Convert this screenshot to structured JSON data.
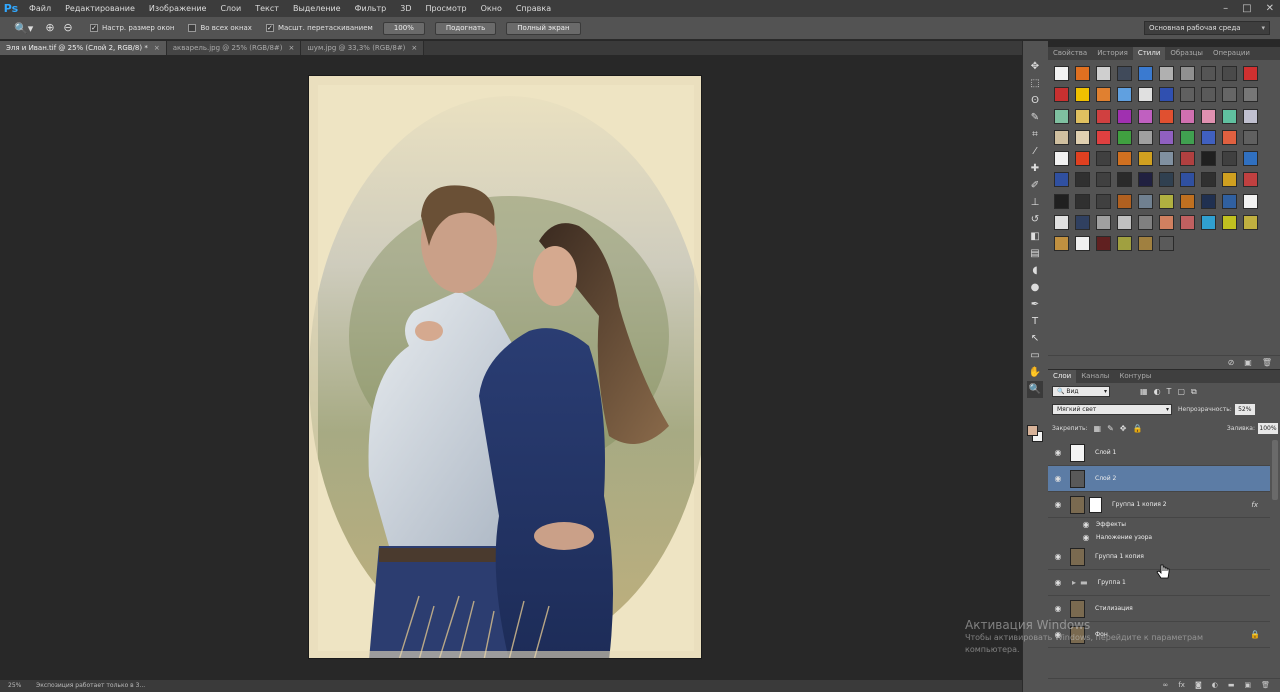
{
  "app": {
    "logo": "Ps"
  },
  "menu": [
    "Файл",
    "Редактирование",
    "Изображение",
    "Слои",
    "Текст",
    "Выделение",
    "Фильтр",
    "3D",
    "Просмотр",
    "Окно",
    "Справка"
  ],
  "window_controls": [
    "–",
    "□",
    "✕"
  ],
  "options_bar": {
    "resize_windows": "Настр. размер окон",
    "all_windows": "Во всех окнах",
    "scrubby_zoom": "Масшт. перетаскиванием",
    "zoom_100": "100%",
    "fit_screen": "Подогнать",
    "fill_screen": "Полный экран",
    "workspace": "Основная рабочая среда"
  },
  "doc_tabs": [
    {
      "label": "Эля и Иван.tif @ 25% (Слой 2, RGB/8) *",
      "close": "×",
      "active": true
    },
    {
      "label": "акварель.jpg @ 25% (RGB/8#)",
      "close": "×",
      "active": false
    },
    {
      "label": "шум.jpg @ 33,3% (RGB/8#)",
      "close": "×",
      "active": false
    }
  ],
  "status": {
    "zoom": "25%",
    "message": "Экспозиция работает только в 3..."
  },
  "styles_panel": {
    "tabs": [
      "Свойства",
      "История",
      "Стили",
      "Образцы",
      "Операции"
    ],
    "active_tab": 2,
    "swatch_colors": [
      "#f2f2f2",
      "#e07020",
      "#cfcfcf",
      "#404a5a",
      "#3a7ad0",
      "#b0b0b0",
      "#909090",
      "#555555",
      "#4a4a4a",
      "#d03030",
      "#c83030",
      "#f0c000",
      "#e08030",
      "#60a0e0",
      "#e0e0e0",
      "#3050b0",
      "#606060",
      "#5a5a5a",
      "#666666",
      "#777777",
      "#7fc0a0",
      "#e0c060",
      "#d04040",
      "#a030b0",
      "#c060c0",
      "#e05030",
      "#d070b0",
      "#e090b0",
      "#60c0a0",
      "#c0c0d0",
      "#d0c0a0",
      "#e0d0b0",
      "#e04040",
      "#40a040",
      "#a0a0a0",
      "#9060c0",
      "#40a050",
      "#4060c0",
      "#e06040",
      "#606060",
      "#f2f2f2",
      "#e04020",
      "#404040",
      "#d07020",
      "#d0a020",
      "#8090a0",
      "#b04040",
      "#202020",
      "#404040",
      "#3070c0",
      "#3050a0",
      "#303030",
      "#404040",
      "#2a2a2a",
      "#202040",
      "#304050",
      "#3050a0",
      "#303030",
      "#d0a020",
      "#c04040",
      "#202020",
      "#303030",
      "#404040",
      "#b06020",
      "#708090",
      "#b0b040",
      "#c07020",
      "#203050",
      "#3060a0",
      "#f2f2f2",
      "#e0e0e0",
      "#304060",
      "#a0a0a0",
      "#c0c0c0",
      "#808080",
      "#d08060",
      "#c06060",
      "#30a0d0",
      "#c0c020",
      "#c0b040",
      "#c09040",
      "#f0f0f0",
      "#602020",
      "#a0a040",
      "#a08040",
      "#5a5a5a"
    ]
  },
  "layers_panel": {
    "tabs": [
      "Слои",
      "Каналы",
      "Контуры"
    ],
    "filter_kind": "Вид",
    "blend_mode": "Мягкий свет",
    "opacity_label": "Непрозрачность:",
    "opacity": "52%",
    "lock_label": "Закрепить:",
    "fill_label": "Заливка:",
    "fill": "100%",
    "layers": [
      {
        "name": "Слой 1",
        "thumb": "#f4f4f4",
        "selected": false
      },
      {
        "name": "Слой 2",
        "thumb": "#595959",
        "selected": true
      },
      {
        "name": "Группа 1 копия 2",
        "thumb": "#7a6a50",
        "selected": false,
        "fx": "fx",
        "mask": true
      },
      {
        "name": "Эффекты",
        "sub": true
      },
      {
        "name": "Наложение узора",
        "sub": true
      },
      {
        "name": "Группа 1 копия",
        "thumb": "#7a6a50",
        "selected": false
      },
      {
        "name": "Группа 1",
        "folder": true,
        "selected": false
      },
      {
        "name": "Стилизация",
        "thumb": "#7a6a50",
        "selected": false
      },
      {
        "name": "Фон",
        "thumb": "#7a6a50",
        "selected": false,
        "locked": true
      }
    ]
  },
  "watermark": {
    "title": "Активация Windows",
    "text": "Чтобы активировать Windows, перейдите к параметрам компьютера."
  }
}
